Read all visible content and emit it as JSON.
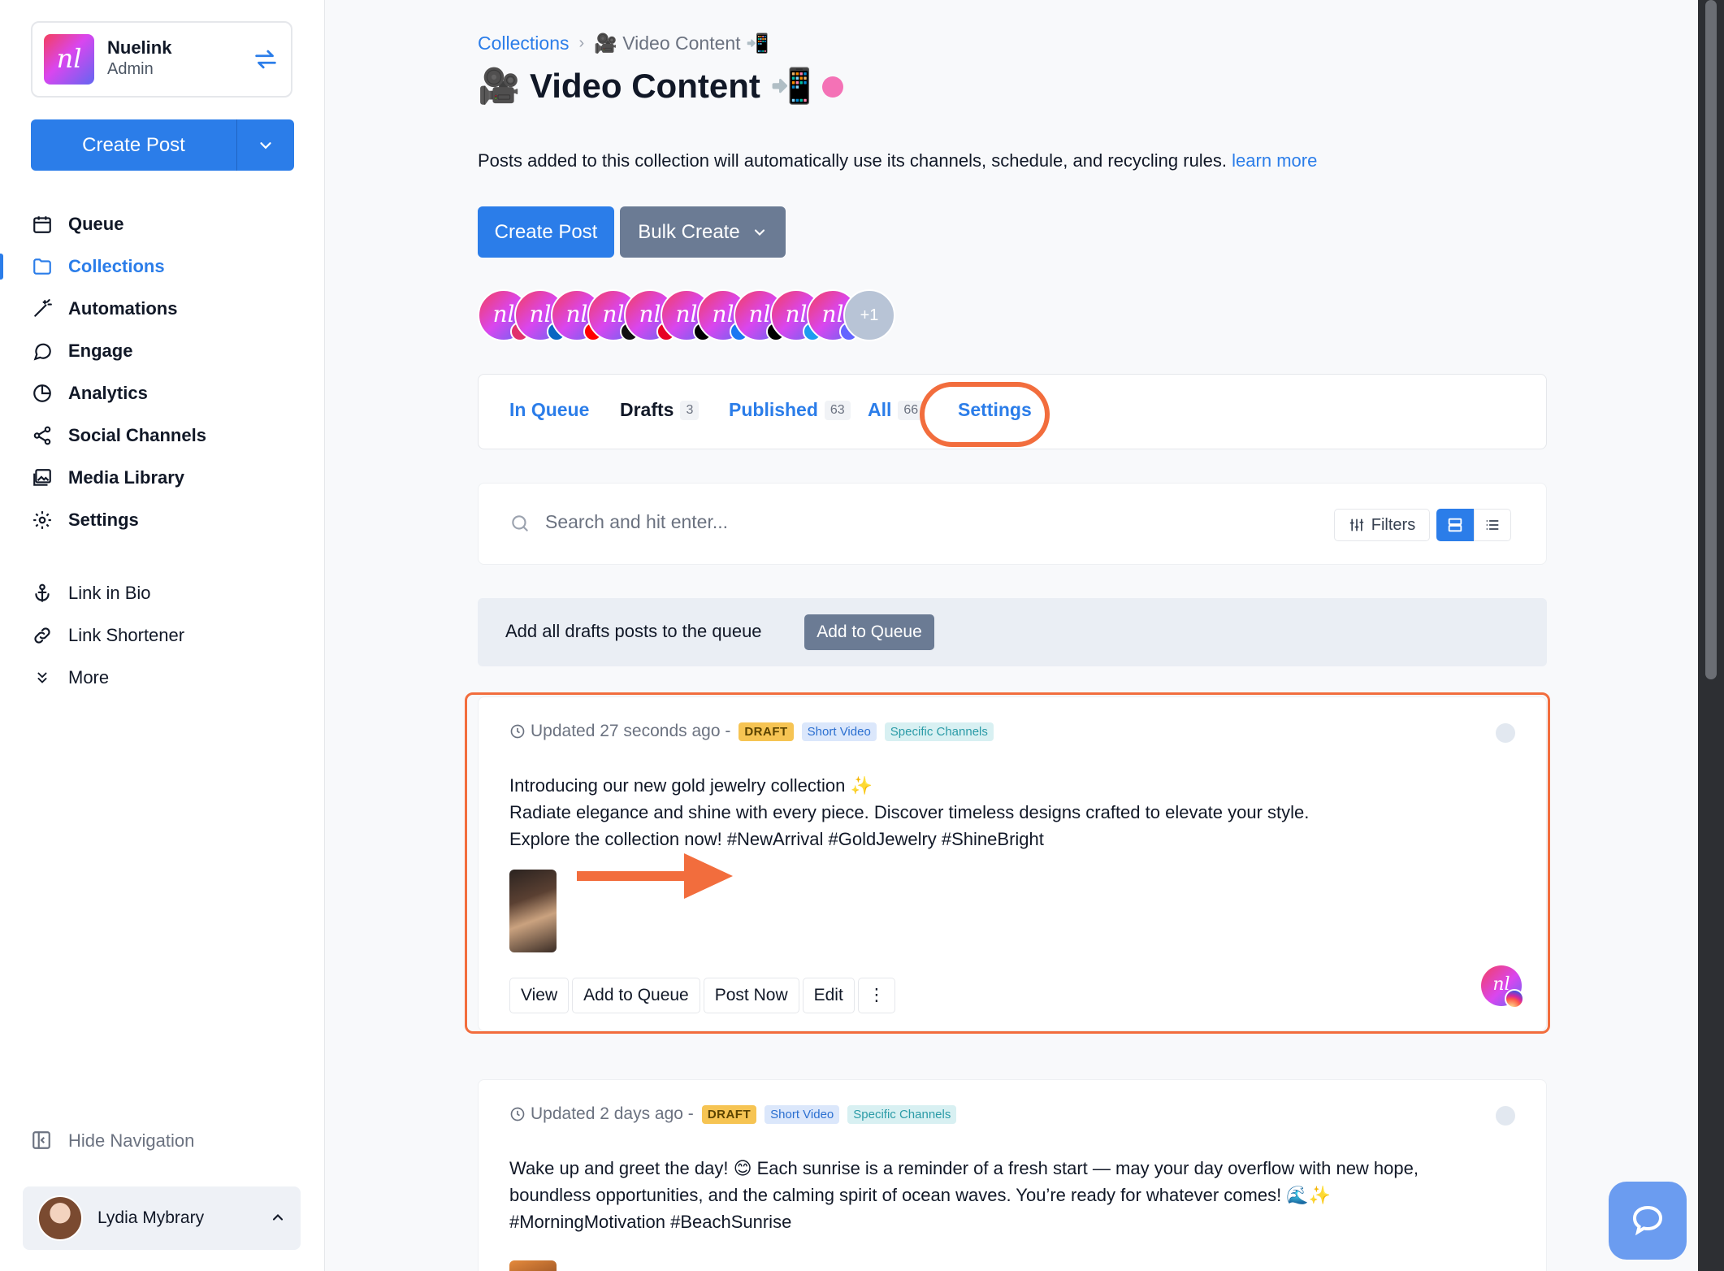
{
  "workspace": {
    "name": "Nuelink",
    "role": "Admin",
    "logo_text": "nl"
  },
  "sidebar": {
    "create_post_label": "Create Post",
    "nav_items": [
      {
        "label": "Queue",
        "icon": "calendar-icon",
        "active": false
      },
      {
        "label": "Collections",
        "icon": "folder-icon",
        "active": true
      },
      {
        "label": "Automations",
        "icon": "magic-wand-icon",
        "active": false
      },
      {
        "label": "Engage",
        "icon": "chat-bubble-icon",
        "active": false
      },
      {
        "label": "Analytics",
        "icon": "pie-chart-icon",
        "active": false
      },
      {
        "label": "Social Channels",
        "icon": "share-icon",
        "active": false
      },
      {
        "label": "Media Library",
        "icon": "images-icon",
        "active": false
      },
      {
        "label": "Settings",
        "icon": "gear-icon",
        "active": false
      }
    ],
    "secondary_items": [
      {
        "label": "Link in Bio",
        "icon": "anchor-icon"
      },
      {
        "label": "Link Shortener",
        "icon": "link-icon"
      },
      {
        "label": "More",
        "icon": "chevrons-down-icon"
      }
    ],
    "hide_navigation_label": "Hide Navigation",
    "user": {
      "name": "Lydia Mybrary"
    }
  },
  "breadcrumb": {
    "root": "Collections",
    "current": "🎥 Video Content 📲"
  },
  "page": {
    "title": "🎥 Video Content 📲",
    "description": "Posts added to this collection will automatically use its channels, schedule, and recycling rules.",
    "learn_more": "learn more",
    "create_post_label": "Create Post",
    "bulk_create_label": "Bulk Create"
  },
  "channels": {
    "networks": [
      "instagram",
      "linkedin",
      "youtube",
      "tiktok",
      "pinterest",
      "threads",
      "facebook",
      "x",
      "bluesky",
      "mastodon"
    ],
    "more_label": "+1"
  },
  "tabs": [
    {
      "label": "In Queue",
      "count": "",
      "active": false
    },
    {
      "label": "Drafts",
      "count": "3",
      "active": true
    },
    {
      "label": "Published",
      "count": "63",
      "active": false
    },
    {
      "label": "All",
      "count": "66",
      "active": false
    },
    {
      "label": "Settings",
      "count": "",
      "active": false
    }
  ],
  "search": {
    "placeholder": "Search and hit enter...",
    "filters_label": "Filters"
  },
  "queue_banner": {
    "text": "Add all drafts posts to the queue",
    "button_label": "Add to Queue"
  },
  "posts": [
    {
      "updated": "Updated 27 seconds ago -",
      "badges": [
        "DRAFT",
        "Short Video",
        "Specific Channels"
      ],
      "lines": [
        "Introducing our new gold jewelry collection ✨",
        "Radiate elegance and shine with every piece. Discover timeless designs crafted to elevate your style.",
        "Explore the collection now! #NewArrival #GoldJewelry #ShineBright"
      ],
      "actions": [
        "View",
        "Add to Queue",
        "Post Now",
        "Edit",
        "⋮"
      ]
    },
    {
      "updated": "Updated 2 days ago -",
      "badges": [
        "DRAFT",
        "Short Video",
        "Specific Channels"
      ],
      "lines": [
        "Wake up and greet the day! 😊 Each sunrise is a reminder of a fresh start — may your day overflow with new hope,",
        "boundless opportunities, and the calming spirit of ocean waves. You’re ready for whatever comes! 🌊✨",
        "#MorningMotivation #BeachSunrise"
      ]
    }
  ],
  "colors": {
    "accent": "#2b7de9",
    "highlight": "#f26d3d",
    "draft": "#f6c453",
    "secondary_button": "#6b7b94"
  }
}
